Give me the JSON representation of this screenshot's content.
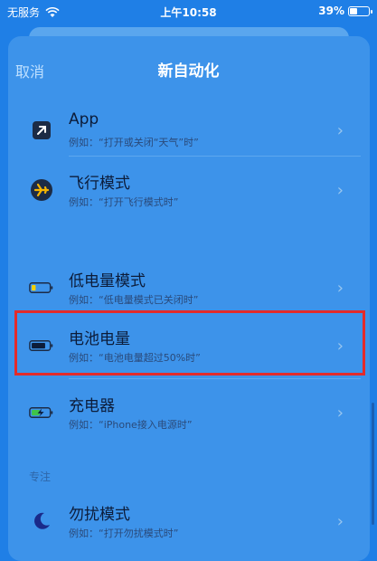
{
  "status_bar": {
    "carrier": "无服务",
    "time": "上午10:58",
    "battery_percent": "39%",
    "battery_level": 0.39
  },
  "nav": {
    "cancel": "取消",
    "title": "新自动化"
  },
  "items": [
    {
      "icon": "app-arrow-icon",
      "title": "App",
      "subtitle": "例如：“打开或关闭“天气”时”"
    },
    {
      "icon": "airplane-icon",
      "title": "飞行模式",
      "subtitle": "例如：“打开飞行模式时”"
    },
    {
      "icon": "low-power-battery-icon",
      "title": "低电量模式",
      "subtitle": "例如：“低电量模式已关闭时”"
    },
    {
      "icon": "battery-icon",
      "title": "电池电量",
      "subtitle": "例如：“电池电量超过50%时”"
    },
    {
      "icon": "charger-icon",
      "title": "充电器",
      "subtitle": "例如：“iPhone接入电源时”"
    },
    {
      "icon": "moon-icon",
      "title": "勿扰模式",
      "subtitle": "例如：“打开勿扰模式时”"
    }
  ],
  "section_focus": "专注",
  "colors": {
    "highlight": "#e32b2b",
    "background": "#1f7fe6"
  }
}
